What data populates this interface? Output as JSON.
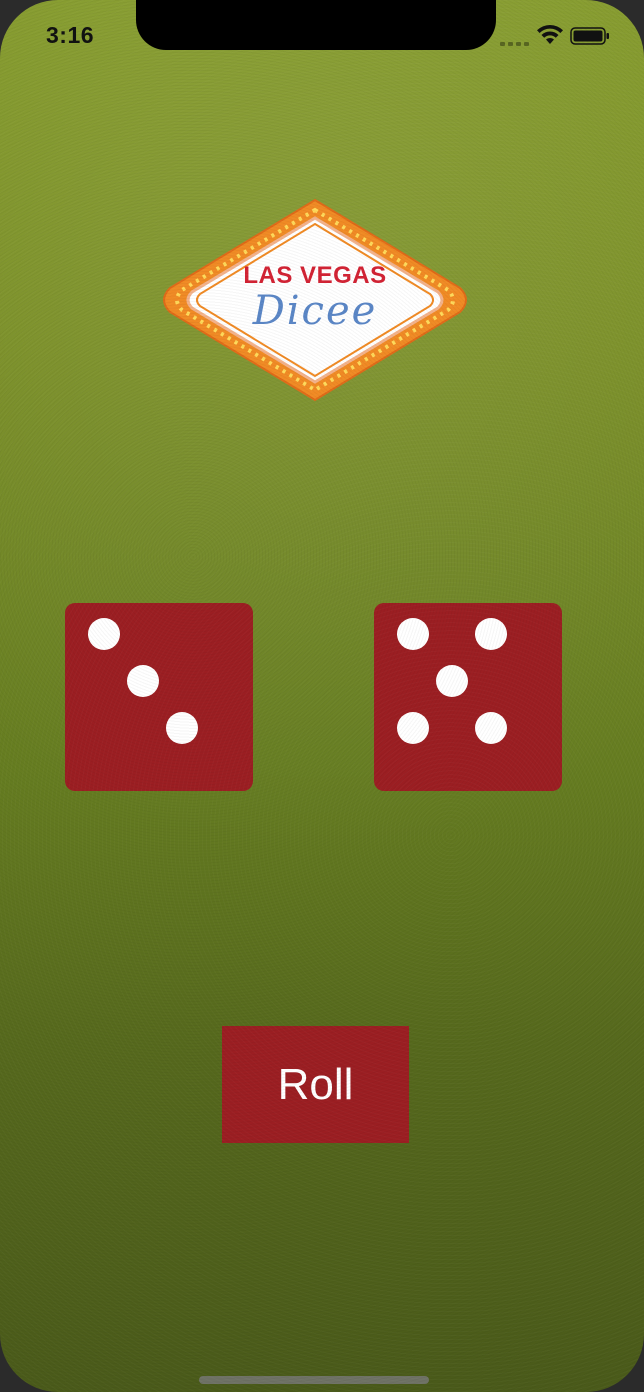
{
  "status_bar": {
    "time": "3:16",
    "icons": [
      "signal-icon",
      "wifi-icon",
      "battery-icon"
    ]
  },
  "logo": {
    "line1": "LAS VEGAS",
    "line2": "Dicee"
  },
  "dice": [
    {
      "name": "left-die",
      "value": 3
    },
    {
      "name": "right-die",
      "value": 5
    }
  ],
  "roll_button": {
    "label": "Roll"
  },
  "colors": {
    "felt_green": "#7a8f26",
    "die_red": "#9b1e22",
    "pip_white": "#ffffff",
    "logo_red": "#d22233",
    "logo_blue": "#5a86c6",
    "logo_orange": "#f08a24"
  }
}
